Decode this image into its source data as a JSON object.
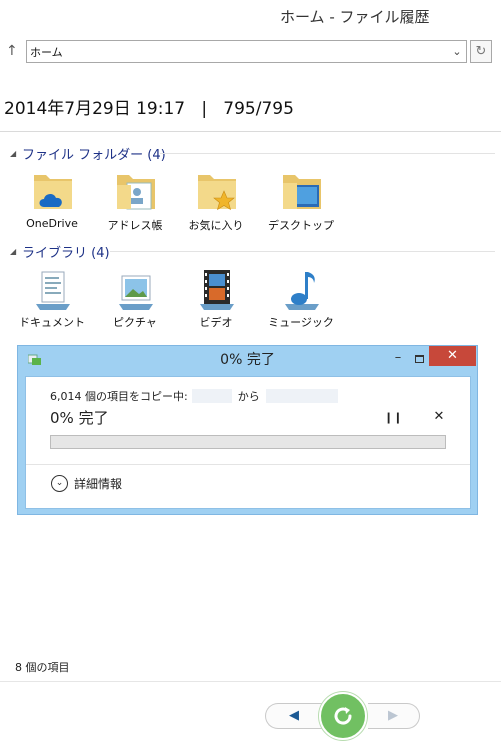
{
  "window": {
    "title": "ホーム - ファイル履歴"
  },
  "address_bar": {
    "value": "ホーム"
  },
  "timestamp": {
    "datetime": "2014年7月29日 19:17",
    "separator": "|",
    "version": "795/795"
  },
  "groups": {
    "folders": {
      "title": "ファイル フォルダー (4)",
      "items": [
        {
          "label": "OneDrive",
          "icon": "onedrive-folder-icon"
        },
        {
          "label": "アドレス帳",
          "icon": "contacts-folder-icon"
        },
        {
          "label": "お気に入り",
          "icon": "favorites-folder-icon"
        },
        {
          "label": "デスクトップ",
          "icon": "desktop-folder-icon"
        }
      ]
    },
    "libraries": {
      "title": "ライブラリ (4)",
      "items": [
        {
          "label": "ドキュメント",
          "icon": "documents-library-icon"
        },
        {
          "label": "ピクチャ",
          "icon": "pictures-library-icon"
        },
        {
          "label": "ビデオ",
          "icon": "videos-library-icon"
        },
        {
          "label": "ミュージック",
          "icon": "music-library-icon"
        }
      ]
    }
  },
  "copy_dialog": {
    "title": "0% 完了",
    "copy_prefix": "6,014 個の項目をコピー中:",
    "from_label": "から",
    "percent_label": "0% 完了",
    "progress": 0,
    "details_label": "詳細情報",
    "close_glyph": "✕",
    "minimize_glyph": "–"
  },
  "status": {
    "item_count": "8 個の項目"
  },
  "colors": {
    "dialog_frame": "#9fd0f2",
    "close_button": "#c7483a",
    "restore_button": "#71c062",
    "group_title": "#1e3287",
    "nav_arrow": "#1c5a94"
  }
}
